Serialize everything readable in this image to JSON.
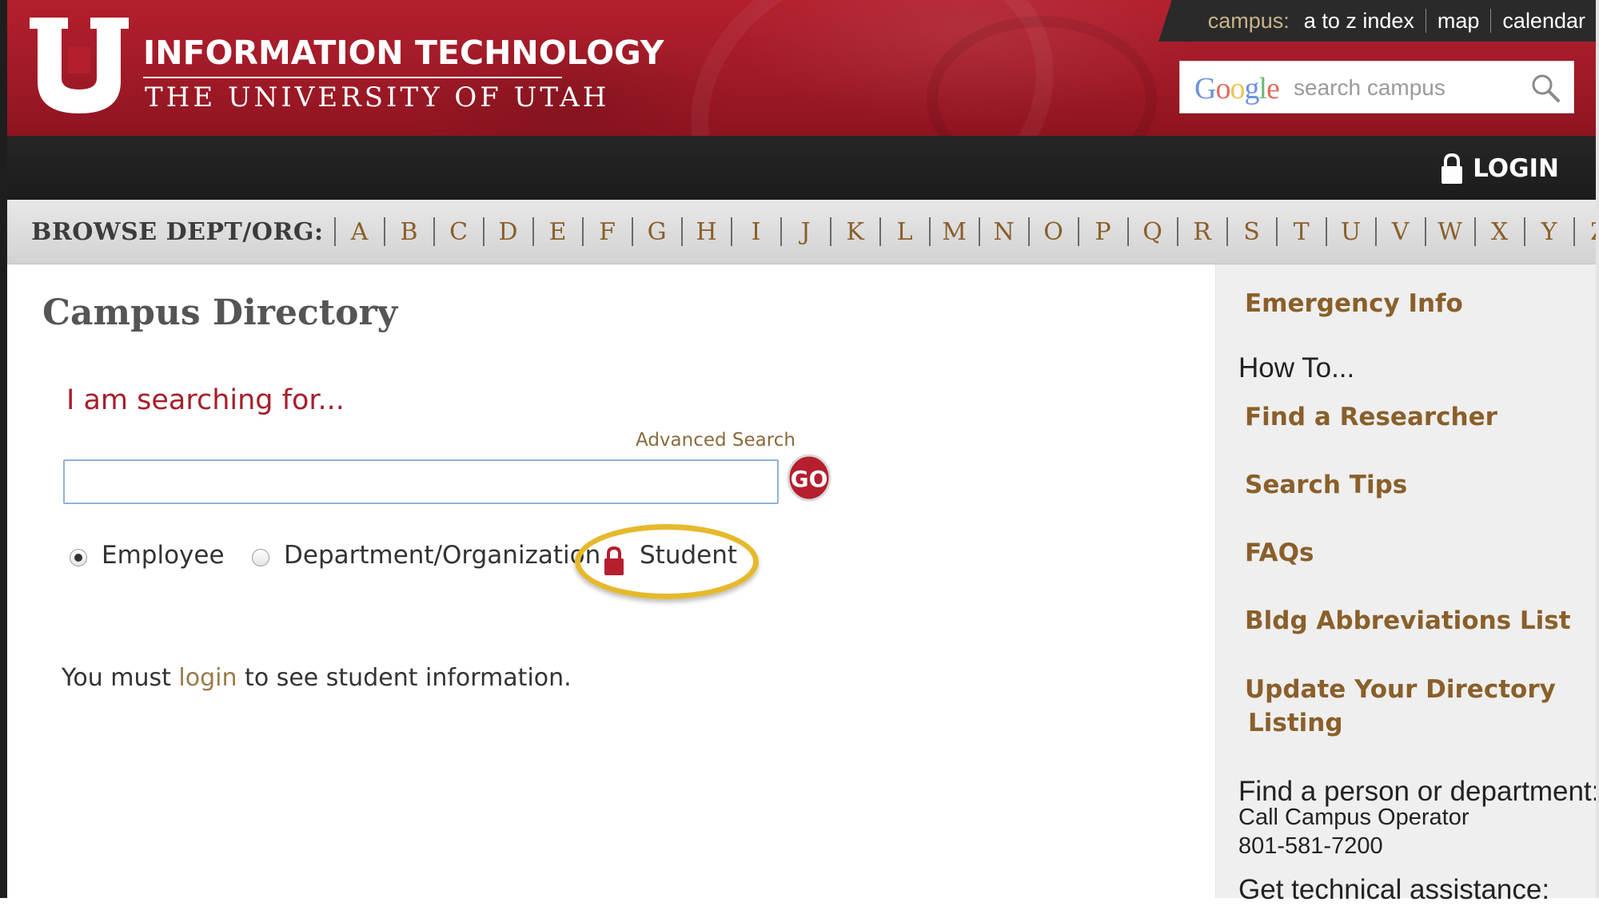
{
  "header": {
    "brand_line1": "INFORMATION TECHNOLOGY",
    "brand_line2": "THE UNIVERSITY OF UTAH",
    "top_links": {
      "campus_label": "campus:",
      "items": [
        "a to z index",
        "map",
        "calendar"
      ]
    },
    "search": {
      "provider": "Google",
      "placeholder": "search campus"
    }
  },
  "login_bar": {
    "login_label": "LOGIN"
  },
  "browse": {
    "label": "BROWSE DEPT/ORG:",
    "letters": [
      "A",
      "B",
      "C",
      "D",
      "E",
      "F",
      "G",
      "H",
      "I",
      "J",
      "K",
      "L",
      "M",
      "N",
      "O",
      "P",
      "Q",
      "R",
      "S",
      "T",
      "U",
      "V",
      "W",
      "X",
      "Y",
      "Z"
    ]
  },
  "main": {
    "title": "Campus Directory",
    "prompt": "I am searching for...",
    "advanced_search": "Advanced Search",
    "search_value": "",
    "go_label": "GO",
    "search_types": [
      {
        "label": "Employee",
        "selected": true
      },
      {
        "label": "Department/Organization",
        "selected": false
      },
      {
        "label": "Student",
        "locked": true
      }
    ],
    "login_note": {
      "before": "You must ",
      "link": "login",
      "after": " to see student information."
    }
  },
  "sidebar": {
    "emergency": "Emergency Info",
    "how_to_heading": "How To...",
    "links": [
      "Find a Researcher",
      "Search Tips",
      "FAQs",
      "Bldg Abbreviations List",
      "Update Your Directory",
      "Listing"
    ],
    "find_heading": "Find a person or department:",
    "call_operator": "Call Campus Operator",
    "phone": "801-581-7200",
    "tech_heading": "Get technical assistance:"
  },
  "colors": {
    "header_red": "#a11a27",
    "link_brown": "#8a5f2a",
    "highlight_gold": "#e6b92c"
  }
}
